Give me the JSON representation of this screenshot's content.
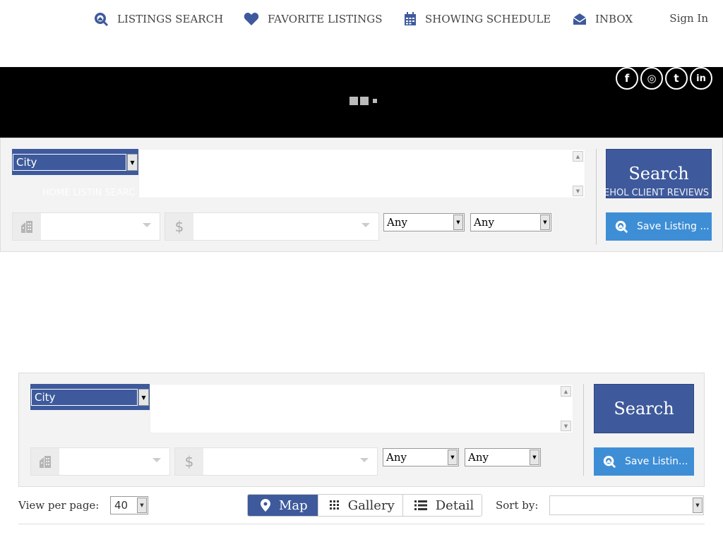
{
  "nav": {
    "items": [
      {
        "label": "LISTINGS SEARCH",
        "icon": "house-search-icon"
      },
      {
        "label": "FAVORITE LISTINGS",
        "icon": "heart-icon"
      },
      {
        "label": "SHOWING SCHEDULE",
        "icon": "calendar-icon"
      },
      {
        "label": "INBOX",
        "icon": "envelope-icon"
      }
    ],
    "sign_in": "Sign In"
  },
  "social": {
    "facebook": "f",
    "instagram": "◎",
    "twitter": "t",
    "linkedin": "in"
  },
  "search_panel_top": {
    "location_type": "City",
    "any_beds": "Any",
    "any_baths": "Any",
    "search_label": "Search",
    "save_label": "Save Listing ..."
  },
  "ghost_text": {
    "left": "HOME   LISTIN SEARC",
    "right": "EHOL   CLIENT REVIEWS"
  },
  "search_panel_bottom": {
    "location_type": "City",
    "any_beds": "Any",
    "any_baths": "Any",
    "search_label": "Search",
    "save_label": "Save Listin..."
  },
  "results_controls": {
    "view_per_page_label": "View per page:",
    "view_per_page_value": "40",
    "views": [
      {
        "label": "Map",
        "icon": "map-marker-icon",
        "active": true
      },
      {
        "label": "Gallery",
        "icon": "grid-icon",
        "active": false
      },
      {
        "label": "Detail",
        "icon": "list-icon",
        "active": false
      }
    ],
    "sort_label": "Sort by:",
    "sort_value": ""
  },
  "colors": {
    "brand_blue": "#3e5a9c",
    "save_blue": "#3e8ed6",
    "banner": "#000000"
  }
}
